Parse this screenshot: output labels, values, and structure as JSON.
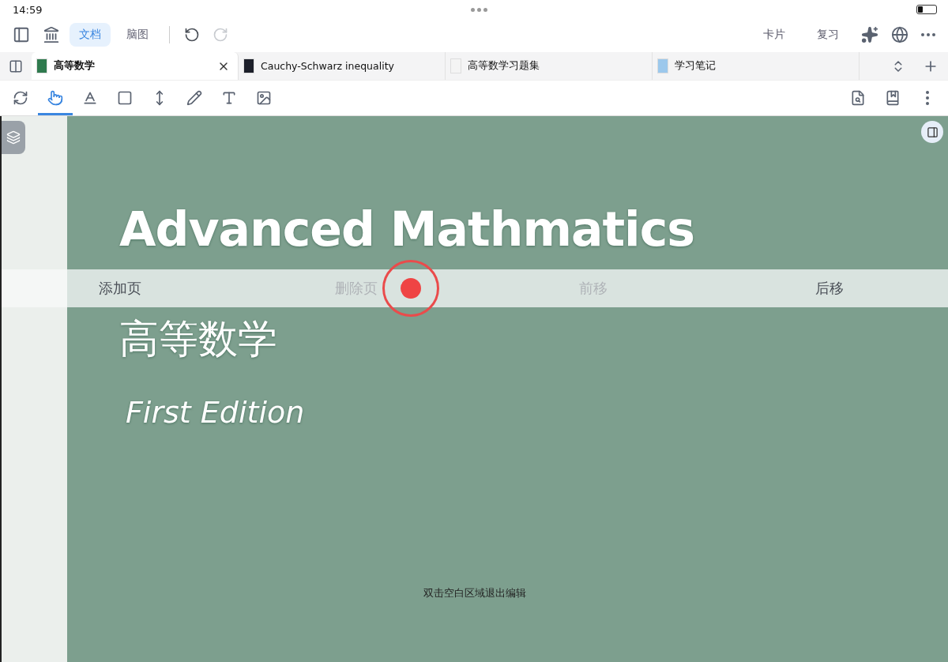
{
  "status_bar": {
    "time": "14:59"
  },
  "toolbar": {
    "mode_tabs": [
      {
        "label": "文档",
        "selected": true
      },
      {
        "label": "脑图",
        "selected": false
      }
    ],
    "undo": {
      "disabled": false
    },
    "redo": {
      "disabled": true
    },
    "right_buttons": [
      "卡片",
      "复习"
    ]
  },
  "doc_tabs": [
    {
      "title": "高等数学",
      "selected": true,
      "color": "#2f7a4e"
    },
    {
      "title": "Cauchy-Schwarz inequality",
      "selected": false,
      "color": "#1c1f2a"
    },
    {
      "title": "高等数学习题集",
      "selected": false,
      "color": "#f4f4f4"
    },
    {
      "title": "学习笔记",
      "selected": false,
      "color": "#9cc8ec"
    }
  ],
  "tools": [
    {
      "kind": "cycle",
      "selected": false
    },
    {
      "kind": "hand",
      "selected": true
    },
    {
      "kind": "highlight",
      "selected": false
    },
    {
      "kind": "rectangle",
      "selected": false
    },
    {
      "kind": "resize",
      "selected": false
    },
    {
      "kind": "pencil",
      "selected": false
    },
    {
      "kind": "textbox",
      "selected": false
    },
    {
      "kind": "image",
      "selected": false
    }
  ],
  "cover": {
    "title": "Advanced Mathmatics",
    "subtitle": "高等数学",
    "edition": "First Edition"
  },
  "page_actions": [
    {
      "label": "添加页",
      "disabled": false
    },
    {
      "label": "删除页",
      "disabled": true
    },
    {
      "label": "前移",
      "disabled": true
    },
    {
      "label": "后移",
      "disabled": false
    }
  ],
  "hint": "双击空白区域退出编辑"
}
